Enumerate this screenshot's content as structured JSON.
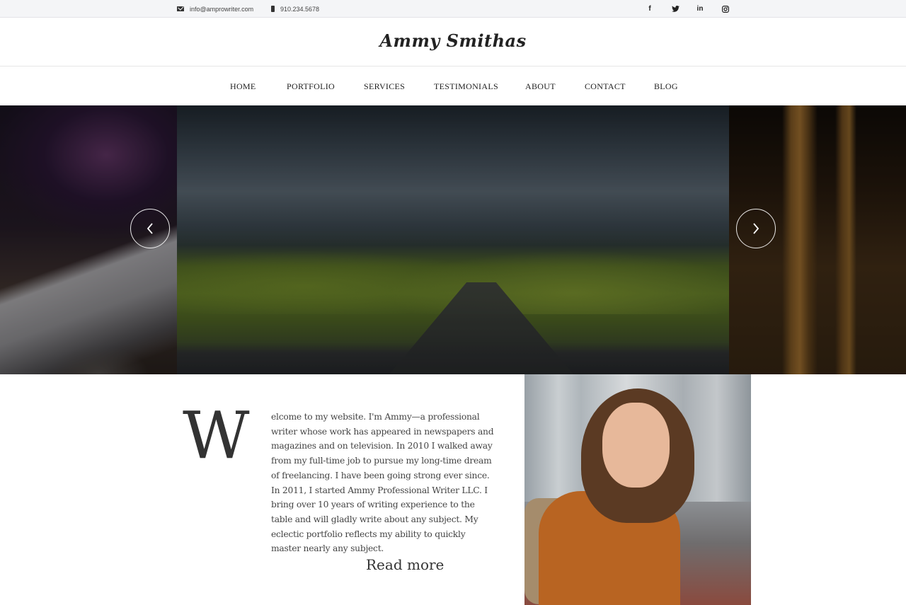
{
  "topbar": {
    "email": "info@amprowriter.com",
    "phone": "910.234.5678",
    "social": [
      {
        "name": "facebook",
        "glyph": "f"
      },
      {
        "name": "twitter",
        "glyph": "t"
      },
      {
        "name": "linkedin",
        "glyph": "in"
      },
      {
        "name": "instagram",
        "glyph": "◎"
      }
    ]
  },
  "header": {
    "logo": "Ammy Smithas"
  },
  "nav": {
    "items": [
      "HOME",
      "PORTFOLIO",
      "SERVICES",
      "TESTIMONIALS",
      "ABOUT",
      "CONTACT",
      "BLOG"
    ]
  },
  "slider": {
    "slides": [
      "space-wreck-scene",
      "highway-wind-farm-scene",
      "industrial-refinery-scene"
    ],
    "prev_icon": "chevron-left-icon",
    "next_icon": "chevron-right-icon"
  },
  "intro": {
    "dropcap": "W",
    "text": "elcome to my website. I'm Ammy—a professional writer whose work has appeared in newspapers and magazines and on television. In 2010 I walked away from my full-time job to pursue my long-time dream of freelancing. I have been going strong ever since. In 2011, I started Ammy Professional Writer LLC. I bring over 10 years of writing experience to the table and will gladly write about any subject. My eclectic portfolio reflects my ability to quickly master nearly any subject.",
    "read_more": "Read more"
  },
  "colors": {
    "topbar_bg": "#f4f5f7",
    "text": "#333333",
    "slider_overlay": "#000000"
  }
}
